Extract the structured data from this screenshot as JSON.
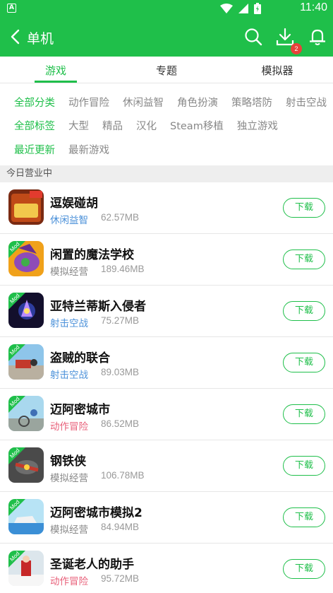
{
  "status_bar": {
    "time": "11:40",
    "icons": [
      "a-notification-icon",
      "wifi-icon",
      "signal-icon",
      "battery-icon"
    ]
  },
  "app_bar": {
    "title": "单机",
    "download_badge": "2",
    "icons": [
      "back-arrow-icon",
      "search-icon",
      "download-icon",
      "bell-icon"
    ]
  },
  "tabs": [
    {
      "label": "游戏",
      "active": true
    },
    {
      "label": "专题",
      "active": false
    },
    {
      "label": "模拟器",
      "active": false
    }
  ],
  "filters": {
    "categories": [
      "全部分类",
      "动作冒险",
      "休闲益智",
      "角色扮演",
      "策略塔防",
      "射击空战"
    ],
    "tags": [
      "全部标签",
      "大型",
      "精品",
      "汉化",
      "Steam移植",
      "独立游戏"
    ],
    "sort": [
      "最近更新",
      "最新游戏"
    ]
  },
  "section_title": "今日营业中",
  "download_label": "下载",
  "colors": {
    "brand_green": "#1fbf4a",
    "category_blue": "#4a90d9",
    "category_red": "#e8607a",
    "category_gray": "#888888"
  },
  "games": [
    {
      "name": "逗娱碰胡",
      "category": "休闲益智",
      "category_color": "#4a90d9",
      "size": "62.57MB",
      "mod": false
    },
    {
      "name": "闲置的魔法学校",
      "category": "模拟经营",
      "category_color": "#888888",
      "size": "189.46MB",
      "mod": true
    },
    {
      "name": "亚特兰蒂斯入侵者",
      "category": "射击空战",
      "category_color": "#4a90d9",
      "size": "75.27MB",
      "mod": true
    },
    {
      "name": "盗贼的联合",
      "category": "射击空战",
      "category_color": "#4a90d9",
      "size": "89.03MB",
      "mod": true
    },
    {
      "name": "迈阿密城市",
      "category": "动作冒险",
      "category_color": "#e8607a",
      "size": "86.52MB",
      "mod": true
    },
    {
      "name": "钢铁侠",
      "category": "模拟经营",
      "category_color": "#888888",
      "size": "106.78MB",
      "mod": true
    },
    {
      "name": "迈阿密城市模拟2",
      "category": "模拟经营",
      "category_color": "#888888",
      "size": "84.94MB",
      "mod": true
    },
    {
      "name": "圣诞老人的助手",
      "category": "动作冒险",
      "category_color": "#e8607a",
      "size": "95.72MB",
      "mod": true
    }
  ]
}
